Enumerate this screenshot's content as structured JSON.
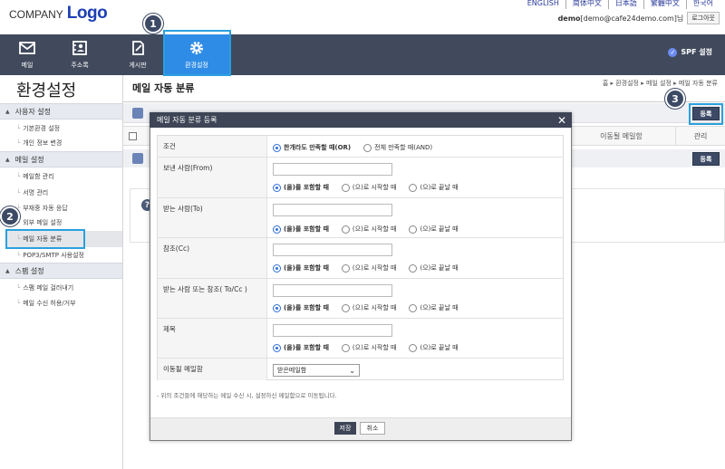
{
  "header": {
    "logo_company": "COMPANY",
    "logo_word": "Logo",
    "languages": [
      "ENGLISH",
      "简体中文",
      "日本語",
      "繁體中文",
      "한국어"
    ],
    "user_id": "demo",
    "user_email": "[demo@cafe24demo.com]님",
    "logout": "로그아웃"
  },
  "nav": {
    "items": [
      {
        "label": "메일",
        "icon": "mail-icon"
      },
      {
        "label": "주소록",
        "icon": "contacts-icon"
      },
      {
        "label": "게시판",
        "icon": "board-icon"
      },
      {
        "label": "환경설정",
        "icon": "gear-icon",
        "active": true
      }
    ],
    "spf": "SPF 설정"
  },
  "badges": [
    "1",
    "2",
    "3"
  ],
  "sidebar": {
    "title": "환경설정",
    "sections": [
      {
        "label": "사용자 설정",
        "items": [
          "기본환경 설정",
          "개인 정보 변경"
        ]
      },
      {
        "label": "메일 설정",
        "items": [
          "메일함 관리",
          "서명 관리",
          "부재중 자동 응답",
          "외부 메일 설정",
          "메일 자동 분류",
          "POP3/SMTP 사용설정"
        ]
      },
      {
        "label": "스팸 설정",
        "items": [
          "스팸 메일 걸러내기",
          "메일 수신 허용/거부"
        ]
      }
    ]
  },
  "main": {
    "title": "메일 자동 분류",
    "breadcrumb": "홈 ▸ 환경설정 ▸ 메일 설정 ▸ 메일 자동 분류",
    "register": "등록",
    "col_mailbox": "이동될 메일함",
    "col_manage": "관리"
  },
  "modal": {
    "title": "메일 자동 분류 등록",
    "close": "✕",
    "condition_label": "조건",
    "condition_options": [
      "한개라도 만족할 때(OR)",
      "전체 만족할 때(AND)"
    ],
    "fields": [
      {
        "label": "보낸 사람(From)",
        "value": ""
      },
      {
        "label": "받는 사람(To)",
        "value": ""
      },
      {
        "label": "참조(Cc)",
        "value": ""
      },
      {
        "label": "받는 사람 또는 참조( To/Cc )",
        "value": ""
      },
      {
        "label": "제목",
        "value": ""
      }
    ],
    "match_options": [
      "(을)를 포함할 때",
      "(으)로 시작할 때",
      "(으)로 끝날 때"
    ],
    "mailbox_label": "이동될 메일함",
    "mailbox_value": "받은메일함",
    "note": "- 위의 조건들에 해당하는 메일 수신 시, 설정하신 메일함으로 이동됩니다.",
    "save": "저장",
    "cancel": "취소"
  }
}
